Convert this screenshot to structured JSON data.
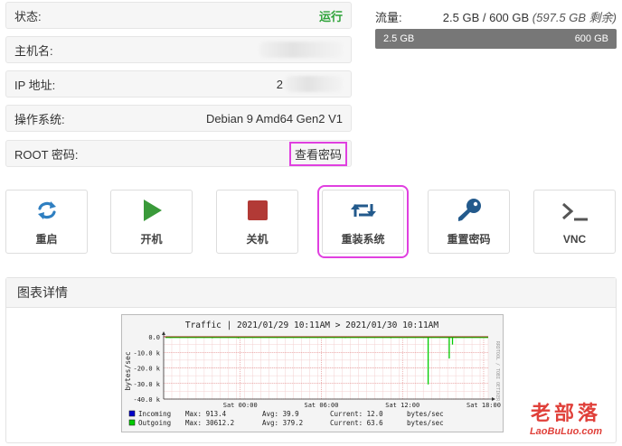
{
  "info": {
    "status_label": "状态:",
    "status_value": "运行",
    "hostname_label": "主机名:",
    "ip_label": "IP 地址:",
    "ip_prefix": "2",
    "os_label": "操作系统:",
    "os_value": "Debian 9 Amd64 Gen2 V1",
    "root_label": "ROOT 密码:",
    "root_link": "查看密码"
  },
  "traffic": {
    "label": "流量:",
    "used_text": "2.5 GB / 600 GB",
    "remaining_text": "(597.5 GB 剩余)",
    "bar_left": "2.5 GB",
    "bar_right": "600 GB",
    "used_fraction": 1.0
  },
  "actions": [
    {
      "label": "重启",
      "icon": "refresh-icon"
    },
    {
      "label": "开机",
      "icon": "play-icon"
    },
    {
      "label": "关机",
      "icon": "stop-icon"
    },
    {
      "label": "重装系统",
      "icon": "retweet-icon"
    },
    {
      "label": "重置密码",
      "icon": "key-icon"
    },
    {
      "label": "VNC",
      "icon": "terminal-icon"
    }
  ],
  "chart_panel": {
    "title": "图表详情"
  },
  "chart_data": {
    "type": "line",
    "title": "Traffic | 2021/01/29 10:11AM > 2021/01/30 10:11AM",
    "ylabel": "bytes/sec",
    "side_label": "RRDTOOL / TOBI OETIKER",
    "yticks": [
      "0.0",
      "-10.0 k",
      "-20.0 k",
      "-30.0 k",
      "-40.0 k"
    ],
    "ylim": [
      -40000,
      0
    ],
    "xticks": [
      "Sat 00:00",
      "Sat 06:00",
      "Sat 12:00",
      "Sat 18:00"
    ],
    "legend": [
      {
        "name": "Incoming",
        "color": "#0000cc",
        "max": "913.4",
        "avg": "39.9",
        "current": "12.0",
        "unit": "bytes/sec"
      },
      {
        "name": "Outgoing",
        "color": "#00cc00",
        "max": "30612.2",
        "avg": "379.2",
        "current": "63.6",
        "unit": "bytes/sec"
      }
    ],
    "legend_labels": {
      "max": "Max:",
      "avg": "Avg:",
      "current": "Current:"
    },
    "series": [
      {
        "name": "Outgoing",
        "color": "#00cc00",
        "spikes": [
          {
            "x": 0.815,
            "y": -30600
          },
          {
            "x": 0.88,
            "y": -14000
          },
          {
            "x": 0.89,
            "y": -5000
          },
          {
            "x": 0.02,
            "y": -800
          },
          {
            "x": 0.15,
            "y": -900
          },
          {
            "x": 0.23,
            "y": -1000
          },
          {
            "x": 0.44,
            "y": -700
          },
          {
            "x": 0.56,
            "y": -800
          },
          {
            "x": 0.7,
            "y": -900
          }
        ]
      }
    ]
  },
  "watermark": {
    "big": "老部落",
    "small": "LaoBuLuo.com"
  }
}
